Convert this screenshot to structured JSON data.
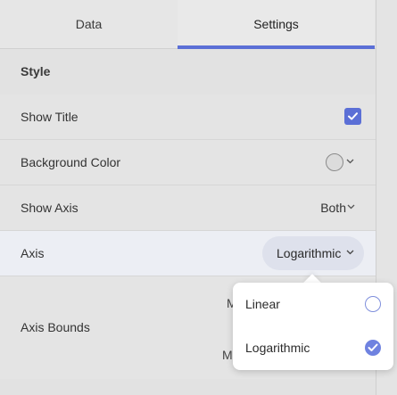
{
  "tabs": [
    {
      "label": "Data",
      "active": false
    },
    {
      "label": "Settings",
      "active": true
    }
  ],
  "accent_color": "#5b6fd6",
  "section": {
    "title": "Style"
  },
  "rows": {
    "show_title": {
      "label": "Show Title",
      "checked": true
    },
    "background_color": {
      "label": "Background Color",
      "icon": "color-swatch-icon"
    },
    "show_axis": {
      "label": "Show Axis",
      "value": "Both"
    },
    "axis": {
      "label": "Axis",
      "value": "Logarithmic"
    },
    "axis_bounds": {
      "label": "Axis Bounds",
      "min_label_fragment": "M",
      "max_label_fragment": "M"
    }
  },
  "dropdown": {
    "options": [
      {
        "label": "Linear",
        "selected": false
      },
      {
        "label": "Logarithmic",
        "selected": true
      }
    ]
  }
}
